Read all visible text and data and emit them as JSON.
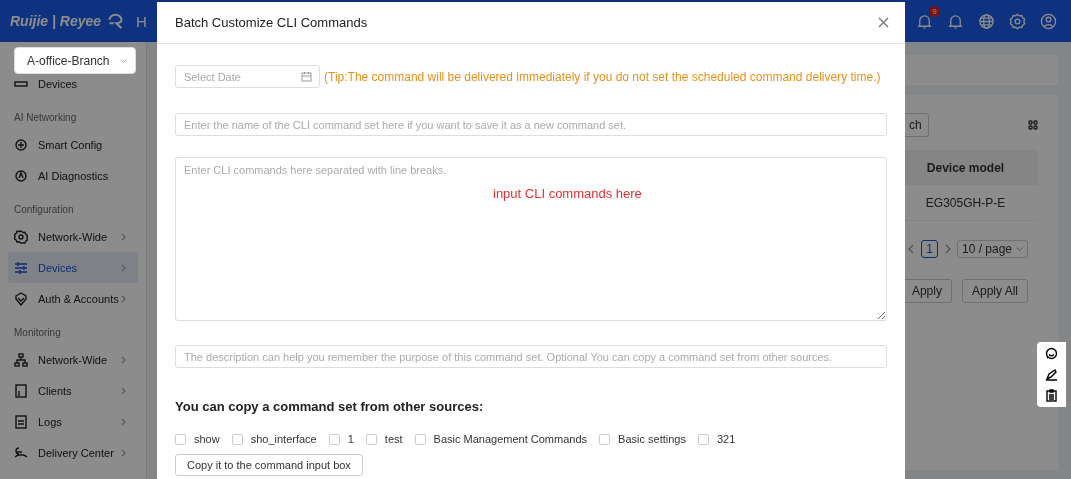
{
  "header": {
    "logo": "Ruijie | Reyee",
    "nav_cut": "H",
    "notification_count": "9"
  },
  "sidebar": {
    "project": "A-office-Branch",
    "items": [
      {
        "kind": "item",
        "label": "Devices",
        "selected": false,
        "expandable": false
      },
      {
        "kind": "heading",
        "label": "AI Networking"
      },
      {
        "kind": "item",
        "label": "Smart Config",
        "selected": false,
        "expandable": false
      },
      {
        "kind": "item",
        "label": "AI Diagnostics",
        "selected": false,
        "expandable": false
      },
      {
        "kind": "heading",
        "label": "Configuration"
      },
      {
        "kind": "item",
        "label": "Network-Wide",
        "selected": false,
        "expandable": true
      },
      {
        "kind": "item",
        "label": "Devices",
        "selected": true,
        "expandable": true
      },
      {
        "kind": "item",
        "label": "Auth & Accounts",
        "selected": false,
        "expandable": true
      },
      {
        "kind": "heading",
        "label": "Monitoring"
      },
      {
        "kind": "item",
        "label": "Network-Wide",
        "selected": false,
        "expandable": true
      },
      {
        "kind": "item",
        "label": "Clients",
        "selected": false,
        "expandable": true
      },
      {
        "kind": "item",
        "label": "Logs",
        "selected": false,
        "expandable": true
      },
      {
        "kind": "item",
        "label": "Delivery Center",
        "selected": false,
        "expandable": true
      }
    ]
  },
  "background": {
    "search_button": "ch",
    "table": {
      "columns": [
        "Device model"
      ],
      "rows": [
        [
          "EG305GH-P-E"
        ]
      ]
    },
    "pagination": {
      "pages": [
        {
          "label": "1",
          "selected": true
        }
      ],
      "page_size": "10 / page"
    },
    "buttons": [
      "Apply",
      "Apply All"
    ]
  },
  "modal": {
    "title": "Batch Customize CLI Commands",
    "date_placeholder": "Select Date",
    "tip": "(Tip:The command will be delivered immediately if you do not set the scheduled command delivery time.)",
    "name_placeholder": "Enter the name of the CLI command set here if you want to save it as a new command set.",
    "commands_placeholder": "Enter CLI commands here separated with line breaks.",
    "commands_annotation": "input CLI commands here",
    "description_placeholder": "The description can help you remember the purpose of this command set. Optional You can copy a command set from other sources.",
    "copy_heading": "You can copy a command set from other sources:",
    "sources": [
      {
        "label": "show",
        "checked": false
      },
      {
        "label": "sho_interface",
        "checked": false
      },
      {
        "label": "1",
        "checked": false
      },
      {
        "label": "test",
        "checked": false
      },
      {
        "label": "Basic Management Commands",
        "checked": false
      },
      {
        "label": "Basic settings",
        "checked": false
      },
      {
        "label": "321",
        "checked": false
      }
    ],
    "copy_button": "Copy it to the command input box"
  }
}
